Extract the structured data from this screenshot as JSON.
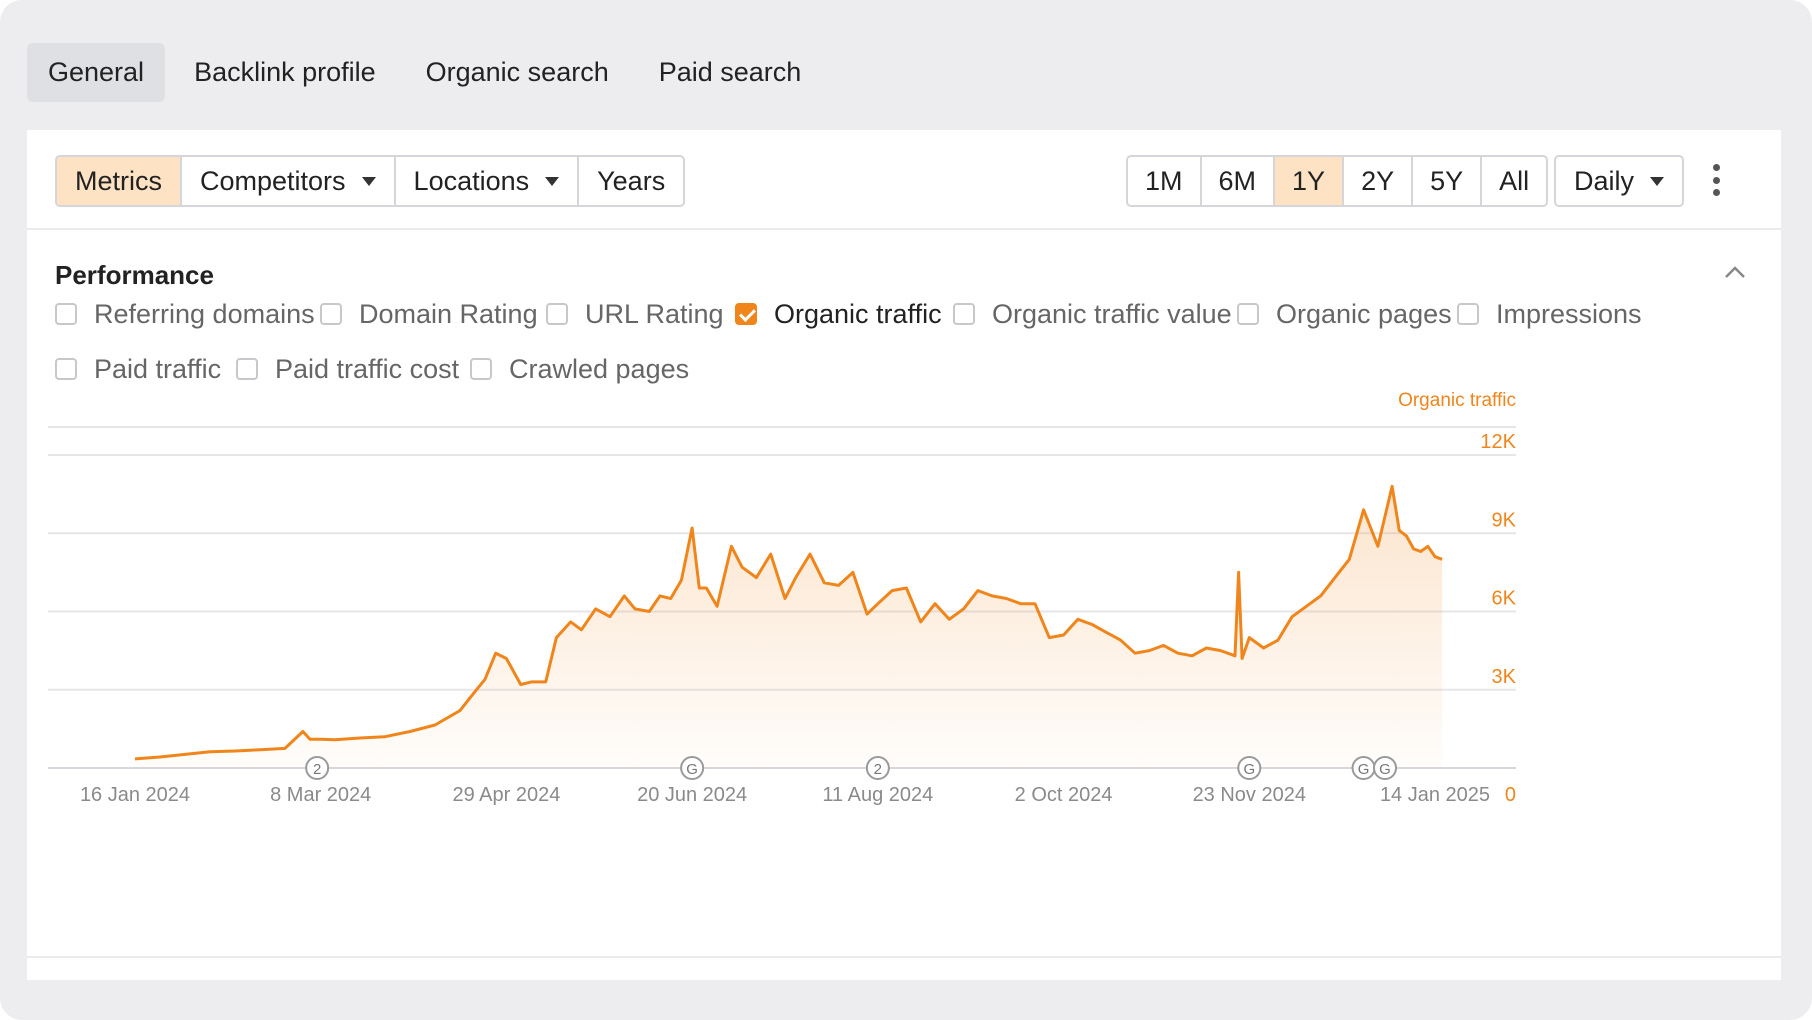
{
  "top_tabs": [
    {
      "label": "General",
      "active": true
    },
    {
      "label": "Backlink profile",
      "active": false
    },
    {
      "label": "Organic search",
      "active": false
    },
    {
      "label": "Paid search",
      "active": false
    }
  ],
  "toolbar": {
    "left_buttons": [
      {
        "label": "Metrics",
        "active": true,
        "dropdown": false
      },
      {
        "label": "Competitors",
        "active": false,
        "dropdown": true
      },
      {
        "label": "Locations",
        "active": false,
        "dropdown": true
      },
      {
        "label": "Years",
        "active": false,
        "dropdown": false
      }
    ],
    "ranges": [
      {
        "label": "1M",
        "active": false
      },
      {
        "label": "6M",
        "active": false
      },
      {
        "label": "1Y",
        "active": true
      },
      {
        "label": "2Y",
        "active": false
      },
      {
        "label": "5Y",
        "active": false
      },
      {
        "label": "All",
        "active": false
      }
    ],
    "granularity": "Daily",
    "more_icon": "kebab-menu-icon"
  },
  "performance": {
    "title": "Performance",
    "collapse_icon": "chevron-up-icon",
    "metrics": [
      {
        "label": "Referring domains",
        "checked": false
      },
      {
        "label": "Domain Rating",
        "checked": false
      },
      {
        "label": "URL Rating",
        "checked": false
      },
      {
        "label": "Organic traffic",
        "checked": true
      },
      {
        "label": "Organic traffic value",
        "checked": false
      },
      {
        "label": "Organic pages",
        "checked": false
      },
      {
        "label": "Impressions",
        "checked": false
      },
      {
        "label": "Paid traffic",
        "checked": false
      },
      {
        "label": "Paid traffic cost",
        "checked": false
      },
      {
        "label": "Crawled pages",
        "checked": false
      }
    ]
  },
  "colors": {
    "accent": "#f0861b",
    "active_bg": "#fde3c3",
    "grid": "#e6e6e9",
    "axis_text": "#8a8a8a"
  },
  "chart_data": {
    "type": "area",
    "series": [
      {
        "name": "Organic traffic",
        "color": "#f0861b"
      }
    ],
    "y_axis_label": "Organic traffic",
    "y_ticks": [
      "0",
      "3K",
      "6K",
      "9K",
      "12K"
    ],
    "ylim": [
      0,
      12000
    ],
    "x_ticks": [
      "16 Jan 2024",
      "8 Mar 2024",
      "29 Apr 2024",
      "20 Jun 2024",
      "11 Aug 2024",
      "2 Oct 2024",
      "23 Nov 2024",
      "14 Jan 2025"
    ],
    "x": [
      "2024-01-16",
      "2024-01-23",
      "2024-01-30",
      "2024-02-06",
      "2024-02-13",
      "2024-02-20",
      "2024-02-27",
      "2024-03-03",
      "2024-03-05",
      "2024-03-08",
      "2024-03-12",
      "2024-03-19",
      "2024-03-26",
      "2024-04-02",
      "2024-04-09",
      "2024-04-16",
      "2024-04-20",
      "2024-04-23",
      "2024-04-26",
      "2024-04-29",
      "2024-05-03",
      "2024-05-06",
      "2024-05-10",
      "2024-05-13",
      "2024-05-17",
      "2024-05-20",
      "2024-05-24",
      "2024-05-28",
      "2024-06-01",
      "2024-06-04",
      "2024-06-08",
      "2024-06-11",
      "2024-06-14",
      "2024-06-17",
      "2024-06-20",
      "2024-06-22",
      "2024-06-24",
      "2024-06-27",
      "2024-07-01",
      "2024-07-04",
      "2024-07-08",
      "2024-07-12",
      "2024-07-16",
      "2024-07-19",
      "2024-07-23",
      "2024-07-27",
      "2024-07-31",
      "2024-08-04",
      "2024-08-08",
      "2024-08-11",
      "2024-08-15",
      "2024-08-19",
      "2024-08-23",
      "2024-08-27",
      "2024-08-31",
      "2024-09-04",
      "2024-09-08",
      "2024-09-12",
      "2024-09-16",
      "2024-09-20",
      "2024-09-24",
      "2024-09-28",
      "2024-10-02",
      "2024-10-06",
      "2024-10-10",
      "2024-10-14",
      "2024-10-18",
      "2024-10-22",
      "2024-10-26",
      "2024-10-30",
      "2024-11-03",
      "2024-11-07",
      "2024-11-11",
      "2024-11-15",
      "2024-11-19",
      "2024-11-20",
      "2024-11-21",
      "2024-11-23",
      "2024-11-27",
      "2024-12-01",
      "2024-12-05",
      "2024-12-09",
      "2024-12-13",
      "2024-12-17",
      "2024-12-21",
      "2024-12-25",
      "2024-12-29",
      "2025-01-02",
      "2025-01-04",
      "2025-01-06",
      "2025-01-08",
      "2025-01-10",
      "2025-01-12",
      "2025-01-14",
      "2025-01-16"
    ],
    "y": [
      350,
      420,
      520,
      620,
      650,
      700,
      750,
      1400,
      1100,
      1100,
      1080,
      1150,
      1200,
      1400,
      1650,
      2200,
      2900,
      3400,
      4400,
      4200,
      3200,
      3300,
      3300,
      5000,
      5600,
      5300,
      6100,
      5800,
      6600,
      6100,
      6000,
      6600,
      6500,
      7200,
      9200,
      6900,
      6900,
      6200,
      8500,
      7700,
      7300,
      8200,
      6500,
      7300,
      8200,
      7100,
      7000,
      7500,
      5900,
      6300,
      6800,
      6900,
      5600,
      6300,
      5700,
      6100,
      6800,
      6600,
      6500,
      6300,
      6300,
      5000,
      5100,
      5700,
      5500,
      5200,
      4900,
      4400,
      4500,
      4700,
      4400,
      4300,
      4600,
      4500,
      4300,
      7500,
      4200,
      5000,
      4600,
      4900,
      5800,
      6200,
      6600,
      7300,
      8000,
      9900,
      8500,
      10800,
      9100,
      8900,
      8400,
      8300,
      8500,
      8100,
      8000
    ],
    "annotations": [
      {
        "x": "2024-03-07",
        "label": "2"
      },
      {
        "x": "2024-06-20",
        "label": "G"
      },
      {
        "x": "2024-08-11",
        "label": "2"
      },
      {
        "x": "2024-11-23",
        "label": "G"
      },
      {
        "x": "2024-12-25",
        "label": "G"
      },
      {
        "x": "2024-12-31",
        "label": "G"
      }
    ]
  }
}
